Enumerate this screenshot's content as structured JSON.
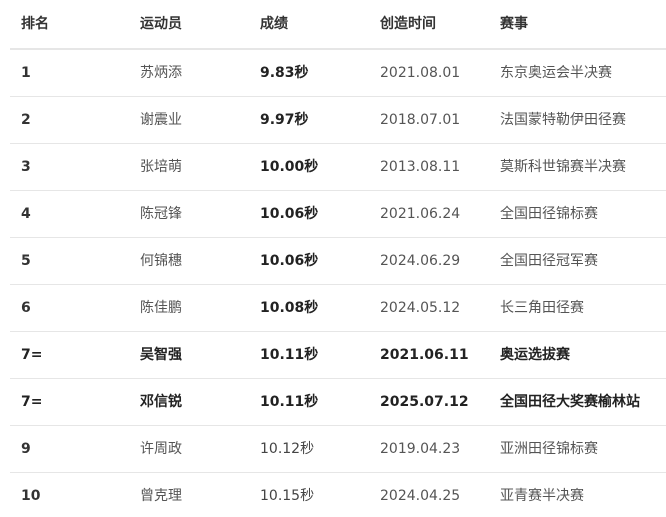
{
  "table": {
    "headers": {
      "rank": "排名",
      "athlete": "运动员",
      "mark": "成绩",
      "date": "创造时间",
      "event": "赛事"
    },
    "rows": [
      {
        "rank": "1",
        "athlete": "苏炳添",
        "mark": "9.83秒",
        "date": "2021.08.01",
        "event": "东京奥运会半决赛",
        "mark_bold": true,
        "row_bold": false
      },
      {
        "rank": "2",
        "athlete": "谢震业",
        "mark": "9.97秒",
        "date": "2018.07.01",
        "event": "法国蒙特勒伊田径赛",
        "mark_bold": true,
        "row_bold": false
      },
      {
        "rank": "3",
        "athlete": "张培萌",
        "mark": "10.00秒",
        "date": "2013.08.11",
        "event": "莫斯科世锦赛半决赛",
        "mark_bold": true,
        "row_bold": false
      },
      {
        "rank": "4",
        "athlete": "陈冠锋",
        "mark": "10.06秒",
        "date": "2021.06.24",
        "event": "全国田径锦标赛",
        "mark_bold": true,
        "row_bold": false
      },
      {
        "rank": "5",
        "athlete": "何锦穗",
        "mark": "10.06秒",
        "date": "2024.06.29",
        "event": "全国田径冠军赛",
        "mark_bold": true,
        "row_bold": false
      },
      {
        "rank": "6",
        "athlete": "陈佳鹏",
        "mark": "10.08秒",
        "date": "2024.05.12",
        "event": "长三角田径赛",
        "mark_bold": true,
        "row_bold": false
      },
      {
        "rank": "7=",
        "athlete": "吴智强",
        "mark": "10.11秒",
        "date": "2021.06.11",
        "event": "奥运选拔赛",
        "mark_bold": true,
        "row_bold": true
      },
      {
        "rank": "7=",
        "athlete": "邓信锐",
        "mark": "10.11秒",
        "date": "2025.07.12",
        "event": "全国田径大奖赛榆林站",
        "mark_bold": true,
        "row_bold": true
      },
      {
        "rank": "9",
        "athlete": "许周政",
        "mark": "10.12秒",
        "date": "2019.04.23",
        "event": "亚洲田径锦标赛",
        "mark_bold": false,
        "row_bold": false
      },
      {
        "rank": "10",
        "athlete": "曾克理",
        "mark": "10.15秒",
        "date": "2024.04.25",
        "event": "亚青赛半决赛",
        "mark_bold": false,
        "row_bold": false
      }
    ]
  }
}
